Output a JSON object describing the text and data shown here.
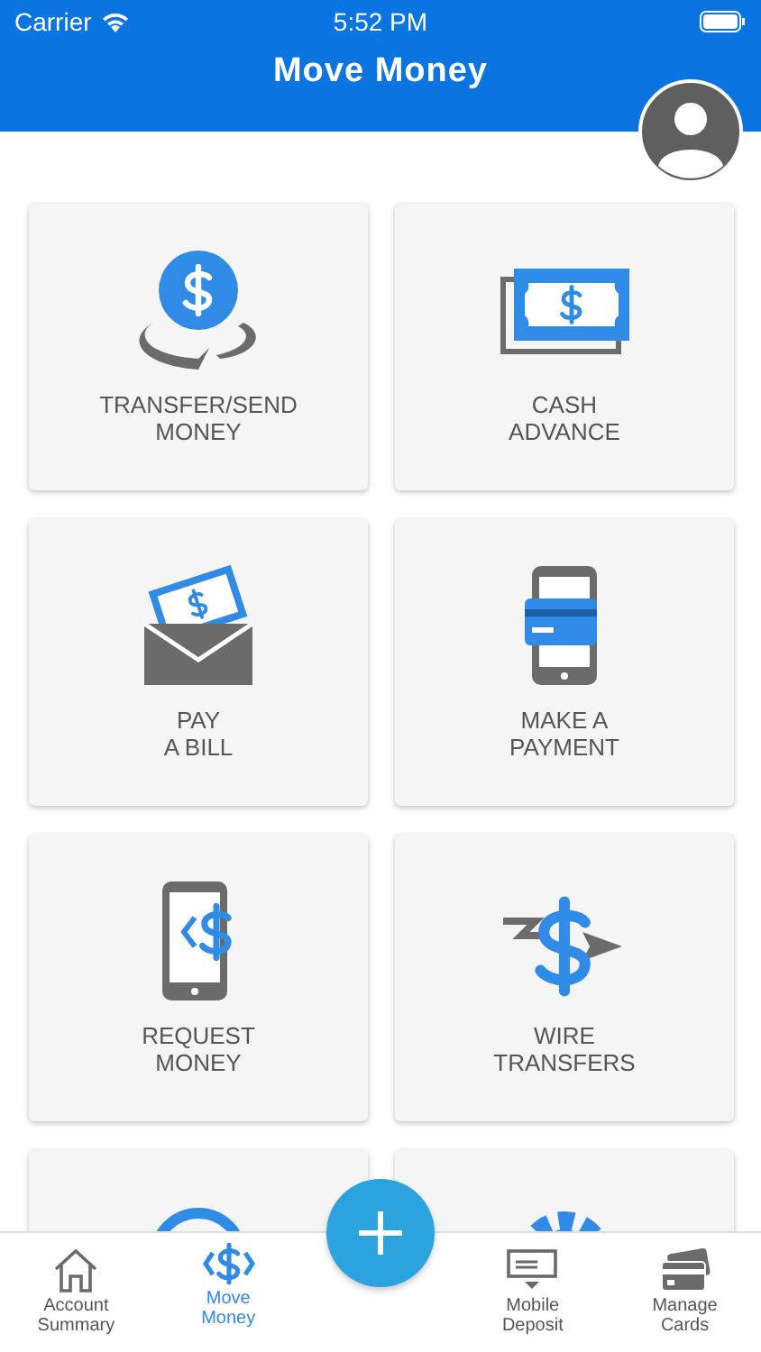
{
  "status_bar": {
    "carrier": "Carrier",
    "time": "5:52 PM"
  },
  "header": {
    "title": "Move Money"
  },
  "cards": [
    {
      "kind": "transfer",
      "label": "TRANSFER/SEND\nMONEY"
    },
    {
      "kind": "cash",
      "label": "CASH\nADVANCE"
    },
    {
      "kind": "bill",
      "label": "PAY\nA BILL"
    },
    {
      "kind": "payment",
      "label": "MAKE A\nPAYMENT"
    },
    {
      "kind": "request",
      "label": "REQUEST\nMONEY"
    },
    {
      "kind": "wire",
      "label": "WIRE\nTRANSFERS"
    },
    {
      "kind": "clock"
    },
    {
      "kind": "gear"
    }
  ],
  "tab_bar": [
    {
      "kind": "home",
      "label": "Account\nSummary",
      "selected": false
    },
    {
      "kind": "money",
      "label": "Move\nMoney",
      "selected": true
    },
    {
      "kind": "fab"
    },
    {
      "kind": "deposit",
      "label": "Mobile\nDeposit",
      "selected": false
    },
    {
      "kind": "cards",
      "label": "Manage\nCards",
      "selected": false
    }
  ]
}
